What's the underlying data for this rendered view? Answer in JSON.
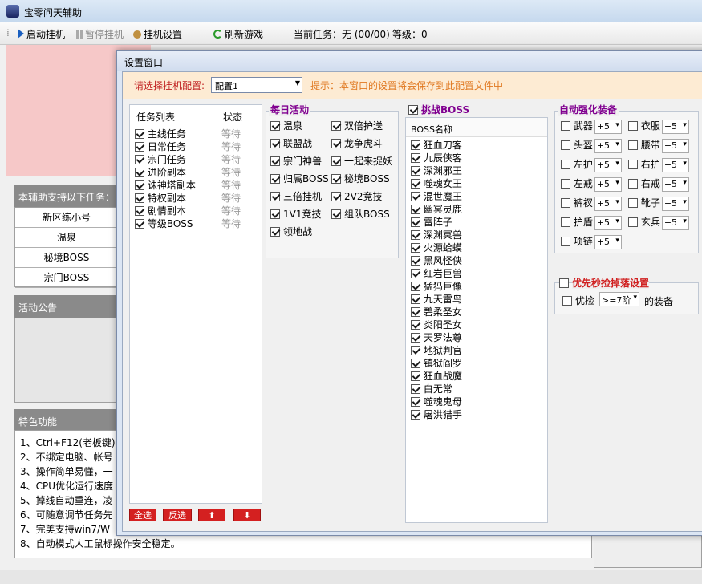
{
  "main": {
    "title": "宝零问天辅助",
    "toolbar": {
      "start": "启动挂机",
      "pause": "暂停挂机",
      "settings": "挂机设置",
      "refresh": "刷新游戏",
      "current_task": "当前任务：无 (00/00)",
      "level": "等级：0"
    },
    "support_header": "本辅助支持以下任务：",
    "support_items": [
      "新区练小号",
      "温泉",
      "秘境BOSS",
      "宗门BOSS"
    ],
    "notice_header": "活动公告",
    "feature_header": "特色功能",
    "features": [
      "1、Ctrl+F12(老板键)",
      "2、不绑定电脑、帐号",
      "3、操作简单易懂，一",
      "4、CPU优化运行速度",
      "5、掉线自动重连，凌",
      "6、可随意调节任务先",
      "7、完美支持win7/W",
      "8、自动模式人工鼠标操作安全稳定。"
    ]
  },
  "dialog": {
    "title": "设置窗口",
    "config_label": "请选择挂机配置:",
    "config_value": "配置1",
    "tip": "提示：本窗口的设置将会保存到此配置文件中",
    "task_list": {
      "col_name": "任务列表",
      "col_status": "状态",
      "rows": [
        {
          "name": "主线任务",
          "status": "等待",
          "checked": true
        },
        {
          "name": "日常任务",
          "status": "等待",
          "checked": true
        },
        {
          "name": "宗门任务",
          "status": "等待",
          "checked": true
        },
        {
          "name": "进阶副本",
          "status": "等待",
          "checked": true
        },
        {
          "name": "诛神塔副本",
          "status": "等待",
          "checked": true
        },
        {
          "name": "特权副本",
          "status": "等待",
          "checked": true
        },
        {
          "name": "剧情副本",
          "status": "等待",
          "checked": true
        },
        {
          "name": "等级BOSS",
          "status": "等待",
          "checked": true
        }
      ],
      "buttons": {
        "all": "全选",
        "invert": "反选",
        "up": "⬆",
        "down": "⬇"
      }
    },
    "daily": {
      "title": "每日活动",
      "items": [
        "温泉",
        "双倍护送",
        "联盟战",
        "龙争虎斗",
        "宗门神兽",
        "一起来捉妖",
        "归属BOSS",
        "秘境BOSS",
        "三倍挂机",
        "2V2竞技",
        "1V1竞技",
        "组队BOSS",
        "领地战"
      ]
    },
    "boss": {
      "title": "挑战BOSS",
      "col": "BOSS名称",
      "items": [
        "狂血刀客",
        "九辰侠客",
        "深渊邪王",
        "噬魂女王",
        "混世魔王",
        "幽冥灵鹿",
        "雷阵子",
        "深渊冥兽",
        "火源蛤蟆",
        "黑风怪侠",
        "红岩巨兽",
        "猛犸巨像",
        "九天雷鸟",
        "碧柔圣女",
        "炎阳圣女",
        "天罗法尊",
        "地狱判官",
        "镇狱阎罗",
        "狂血战魔",
        "白无常",
        "噬魂鬼母",
        "屠洪猎手"
      ]
    },
    "enhance": {
      "title": "自动强化装备",
      "items": [
        {
          "name": "武器",
          "value": "+5"
        },
        {
          "name": "衣服",
          "value": "+5"
        },
        {
          "name": "头盔",
          "value": "+5"
        },
        {
          "name": "腰带",
          "value": "+5"
        },
        {
          "name": "左护",
          "value": "+5"
        },
        {
          "name": "右护",
          "value": "+5"
        },
        {
          "name": "左戒",
          "value": "+5"
        },
        {
          "name": "右戒",
          "value": "+5"
        },
        {
          "name": "裤衩",
          "value": "+5"
        },
        {
          "name": "靴子",
          "value": "+5"
        },
        {
          "name": "护盾",
          "value": "+5"
        },
        {
          "name": "玄兵",
          "value": "+5"
        },
        {
          "name": "项链",
          "value": "+5"
        }
      ]
    },
    "loot": {
      "title": "优先秒捡掉落设置",
      "label": "优捡",
      "value": ">=7阶",
      "suffix": "的装备"
    }
  }
}
